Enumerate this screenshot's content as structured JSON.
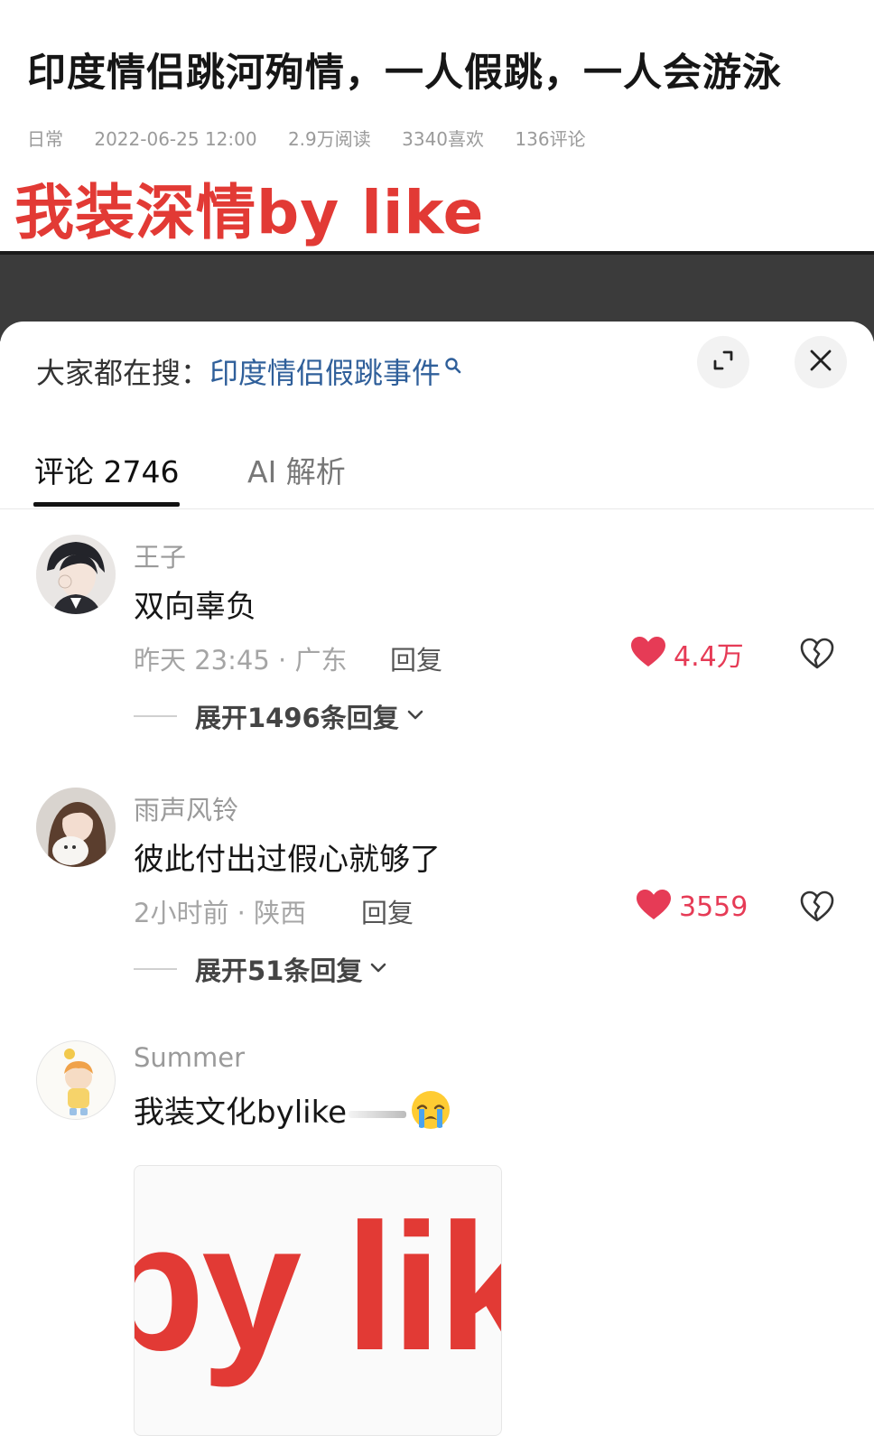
{
  "article": {
    "title": "印度情侣跳河殉情，一人假跳，一人会游泳",
    "category": "日常",
    "datetime": "2022-06-25 12:00",
    "reads": "2.9万阅读",
    "likes": "3340喜欢",
    "comments": "136评论",
    "overlay_caption": "我装深情by like"
  },
  "sheet": {
    "search_prefix": "大家都在搜：",
    "search_term": "印度情侣假跳事件",
    "tabs": {
      "comments": "评论 2746",
      "ai": "AI 解析"
    }
  },
  "comments": [
    {
      "user": "王子",
      "text": "双向辜负",
      "meta": "昨天 23:45 · 广东",
      "reply": "回复",
      "likes": "4.4万",
      "expand": "展开1496条回复"
    },
    {
      "user": "雨声风铃",
      "text": "彼此付出过假心就够了",
      "meta": "2小时前 · 陕西",
      "reply": "回复",
      "likes": "3559",
      "expand": "展开51条回复"
    },
    {
      "user": "Summer",
      "text": "我装文化bylike",
      "image_text": "by lik"
    }
  ],
  "colors": {
    "accent_red": "#e23a35",
    "like_red": "#e63b56",
    "search_blue": "#2f5f9a"
  },
  "icons": {
    "expand": "expand-icon",
    "close": "close-icon",
    "search": "search-icon",
    "heart": "heart-icon",
    "broken_heart": "broken-heart-icon",
    "chevron": "chevron-down-icon",
    "emoji": "crying-face-emoji"
  }
}
